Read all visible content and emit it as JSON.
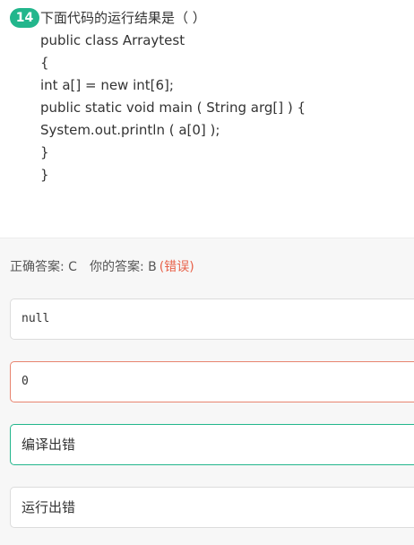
{
  "question": {
    "number": "14",
    "title": "下面代码的运行结果是（ ）",
    "code_lines": [
      "public class Arraytest",
      "{",
      "int a[] = new int[6];",
      "public static void main ( String arg[] ) {",
      "System.out.println ( a[0] );",
      "}",
      "}"
    ]
  },
  "answer": {
    "correct_label": "正确答案: C",
    "yours_label": "你的答案: B",
    "status": "(错误)"
  },
  "options": [
    {
      "text": "null",
      "state": "normal"
    },
    {
      "text": "0",
      "state": "wrong"
    },
    {
      "text": "编译出错",
      "state": "correct"
    },
    {
      "text": "运行出错",
      "state": "normal"
    }
  ],
  "colors": {
    "accent_green": "#22b68c",
    "error_red": "#e8624a"
  }
}
